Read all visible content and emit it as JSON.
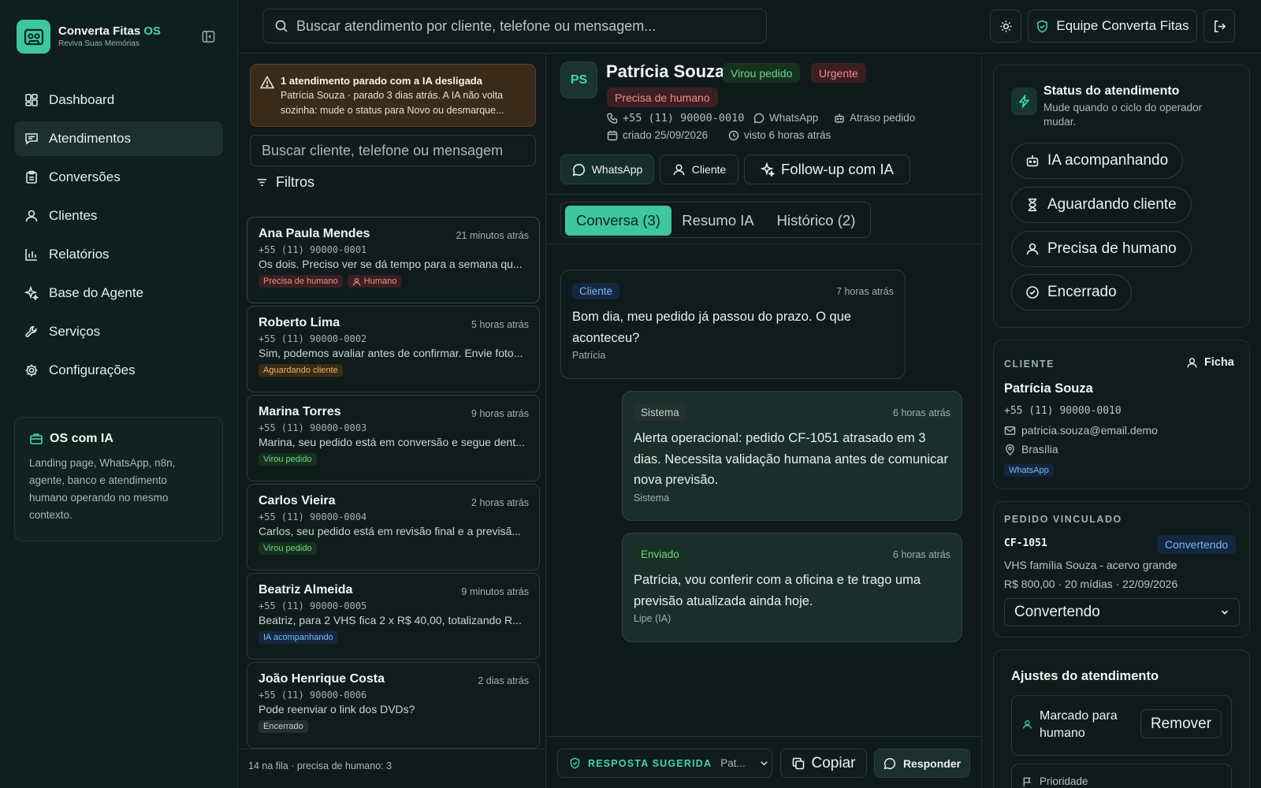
{
  "brand": {
    "name": "Converta Fitas",
    "suffix": "OS",
    "tagline": "Reviva Suas Memórias"
  },
  "nav": [
    {
      "label": "Dashboard",
      "icon": "dashboard-icon"
    },
    {
      "label": "Atendimentos",
      "icon": "chat-icon",
      "active": true
    },
    {
      "label": "Conversões",
      "icon": "clipboard-icon"
    },
    {
      "label": "Clientes",
      "icon": "users-icon"
    },
    {
      "label": "Relatórios",
      "icon": "chart-icon"
    },
    {
      "label": "Base do Agente",
      "icon": "sparkles-icon"
    },
    {
      "label": "Serviços",
      "icon": "wrench-icon"
    },
    {
      "label": "Configurações",
      "icon": "gear-icon"
    }
  ],
  "promo": {
    "title": "OS com IA",
    "text": "Landing page, WhatsApp, n8n, agente, banco e atendimento humano operando no mesmo contexto."
  },
  "topbar": {
    "search_placeholder": "Buscar atendimento por cliente, telefone ou mensagem...",
    "team": "Equipe Converta Fitas"
  },
  "alert": {
    "title": "1 atendimento parado com a IA desligada",
    "text": "Patrícia Souza · parado 3 dias atrás. A IA não volta sozinha: mude o status para Novo ou desmarque..."
  },
  "list": {
    "search_placeholder": "Buscar cliente, telefone ou mensagem",
    "filters_label": "Filtros",
    "items": [
      {
        "name": "Ana Paula Mendes",
        "time": "21 minutos atrás",
        "phone": "+55 (11) 90000-0001",
        "message": "Os dois. Preciso ver se dá tempo para a semana qu...",
        "tags": [
          {
            "label": "Precisa de humano",
            "kind": "red"
          },
          {
            "label": "Humano",
            "kind": "red"
          }
        ]
      },
      {
        "name": "Roberto Lima",
        "time": "5 horas atrás",
        "phone": "+55 (11) 90000-0002",
        "message": "Sim, podemos avaliar antes de confirmar. Envie foto...",
        "tags": [
          {
            "label": "Aguardando cliente",
            "kind": "amber"
          }
        ]
      },
      {
        "name": "Marina Torres",
        "time": "9 horas atrás",
        "phone": "+55 (11) 90000-0003",
        "message": "Marina, seu pedido está em conversão e segue dent...",
        "tags": [
          {
            "label": "Virou pedido",
            "kind": "green"
          }
        ]
      },
      {
        "name": "Carlos Vieira",
        "time": "2 horas atrás",
        "phone": "+55 (11) 90000-0004",
        "message": "Carlos, seu pedido está em revisão final e a previsã...",
        "tags": [
          {
            "label": "Virou pedido",
            "kind": "green"
          }
        ]
      },
      {
        "name": "Beatriz Almeida",
        "time": "9 minutos atrás",
        "phone": "+55 (11) 90000-0005",
        "message": "Beatriz, para 2 VHS fica 2 x R$ 40,00, totalizando R...",
        "tags": [
          {
            "label": "IA acompanhando",
            "kind": "blue"
          }
        ]
      },
      {
        "name": "João Henrique Costa",
        "time": "2 dias atrás",
        "phone": "+55 (11) 90000-0006",
        "message": "Pode reenviar o link dos DVDs?",
        "tags": [
          {
            "label": "Encerrado",
            "kind": "gray"
          }
        ]
      }
    ],
    "footer": "14 na fila · precisa de humano: 3"
  },
  "conversation": {
    "initials": "PS",
    "name": "Patrícia Souza",
    "badges": {
      "pedido": "Virou pedido",
      "urgente": "Urgente",
      "humano": "Precisa de humano"
    },
    "phone": "+55 (11) 90000-0010",
    "channel": "WhatsApp",
    "delay": "Atraso pedido",
    "created": "criado 25/09/2026",
    "seen": "visto 6 horas atrás",
    "actions": {
      "whatsapp": "WhatsApp",
      "cliente": "Cliente",
      "followup": "Follow-up com IA"
    },
    "tabs": [
      "Conversa (3)",
      "Resumo IA",
      "Histórico (2)"
    ],
    "messages": [
      {
        "role": "Cliente",
        "time": "7 horas atrás",
        "text": "Bom dia, meu pedido já passou do prazo. O que aconteceu?",
        "sign": "Patrícia"
      },
      {
        "role": "Sistema",
        "time": "6 horas atrás",
        "text": "Alerta operacional: pedido CF-1051 atrasado em 3 dias. Necessita validação humana antes de comunicar nova previsão.",
        "sign": "Sistema"
      },
      {
        "role": "Enviado",
        "time": "6 horas atrás",
        "text": "Patrícia, vou conferir com a oficina e te trago uma previsão atualizada ainda hoje.",
        "sign": "Lipe (IA)"
      }
    ],
    "footer": {
      "suggested_label": "RESPOSTA SUGERIDA",
      "suggested_preview": "Pat...",
      "copy": "Copiar",
      "reply": "Responder"
    }
  },
  "status_panel": {
    "title": "Status do atendimento",
    "subtitle": "Mude quando o ciclo do operador mudar.",
    "options": [
      "IA acompanhando",
      "Aguardando cliente",
      "Precisa de humano",
      "Encerrado"
    ]
  },
  "client_panel": {
    "section": "CLIENTE",
    "ficha": "Ficha",
    "name": "Patrícia Souza",
    "phone": "+55 (11) 90000-0010",
    "email": "patricia.souza@email.demo",
    "city": "Brasília",
    "channel": "WhatsApp"
  },
  "order_panel": {
    "section": "PEDIDO VINCULADO",
    "code": "CF-1051",
    "status": "Convertendo",
    "title": "VHS família Souza - acervo grande",
    "details": "R$ 800,00 · 20 mídias · 22/09/2026",
    "select_value": "Convertendo"
  },
  "adjust_panel": {
    "title": "Ajustes do atendimento",
    "marked": "Marcado para humano",
    "remove": "Remover",
    "priority": "Prioridade"
  },
  "colors": {
    "accent": "#3ec79e",
    "background": "#0e1b1a",
    "danger": "#f08d89",
    "warning": "#eab266",
    "success": "#6fd68d",
    "info": "#7ab7f2"
  }
}
